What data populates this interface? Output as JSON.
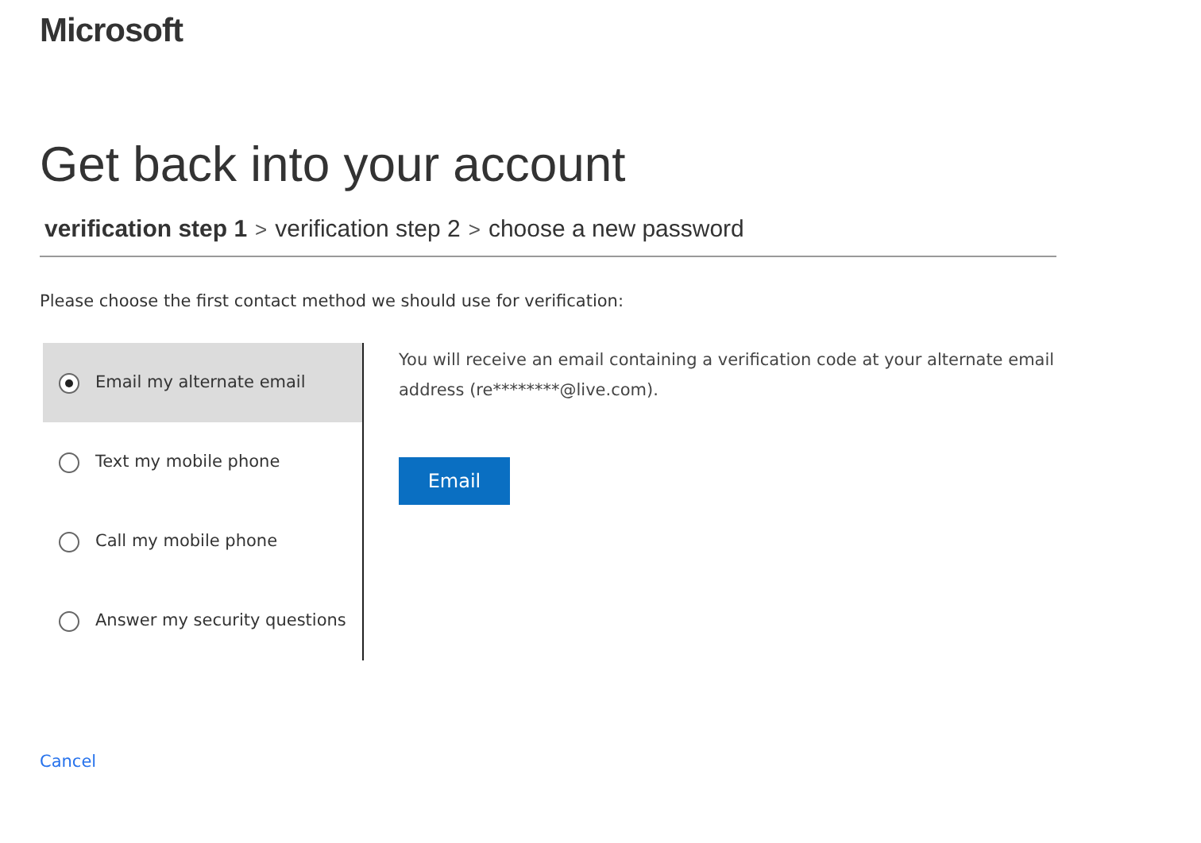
{
  "logo": "Microsoft",
  "title": "Get back into your account",
  "breadcrumb": {
    "separator": ">",
    "steps": [
      {
        "label": "verification step 1",
        "selected": true
      },
      {
        "label": "verification step 2",
        "selected": false
      },
      {
        "label": "choose a new password",
        "selected": false
      }
    ]
  },
  "instruction": "Please choose the first contact method we should use for verification:",
  "methods": [
    {
      "label": "Email my alternate email",
      "selected": true
    },
    {
      "label": "Text my mobile phone",
      "selected": false
    },
    {
      "label": "Call my mobile phone",
      "selected": false
    },
    {
      "label": "Answer my security questions",
      "selected": false
    }
  ],
  "detail": {
    "text": "You will receive an email containing a verification code at your alternate email address (re********@live.com).",
    "button": "Email"
  },
  "cancel": "Cancel"
}
